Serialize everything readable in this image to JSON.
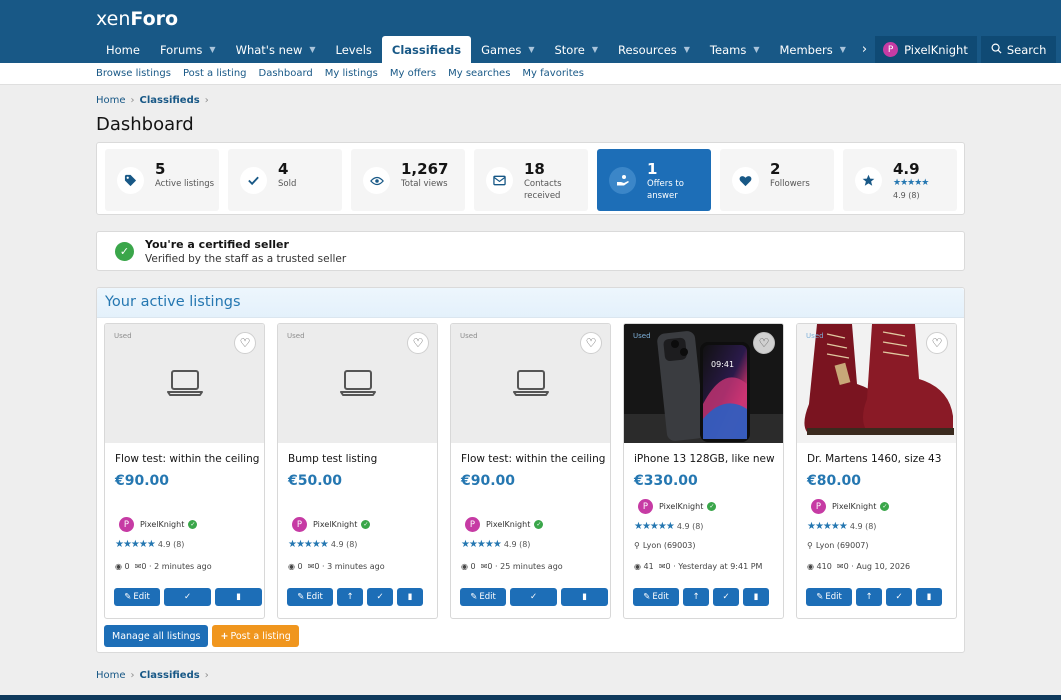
{
  "brand": {
    "logo_light": "xen",
    "logo_bold": "Foro"
  },
  "nav": {
    "tabs": [
      {
        "label": "Home",
        "caret": false,
        "active": false
      },
      {
        "label": "Forums",
        "caret": true,
        "active": false
      },
      {
        "label": "What's new",
        "caret": true,
        "active": false
      },
      {
        "label": "Levels",
        "caret": false,
        "active": false
      },
      {
        "label": "Classifieds",
        "caret": false,
        "active": true
      },
      {
        "label": "Games",
        "caret": true,
        "active": false
      },
      {
        "label": "Store",
        "caret": true,
        "active": false
      },
      {
        "label": "Resources",
        "caret": true,
        "active": false
      },
      {
        "label": "Teams",
        "caret": true,
        "active": false
      },
      {
        "label": "Members",
        "caret": true,
        "active": false
      }
    ],
    "user_initial": "P",
    "user_name": "PixelKnight",
    "search_label": "Search"
  },
  "subnav": [
    "Browse listings",
    "Post a listing",
    "Dashboard",
    "My listings",
    "My offers",
    "My searches",
    "My favorites"
  ],
  "breadcrumb": {
    "home": "Home",
    "section": "Classifieds"
  },
  "page_title": "Dashboard",
  "stats": [
    {
      "value": "5",
      "label": "Active listings",
      "icon": "tag-icon"
    },
    {
      "value": "4",
      "label": "Sold",
      "icon": "check-icon"
    },
    {
      "value": "1,267",
      "label": "Total views",
      "icon": "eye-icon"
    },
    {
      "value": "18",
      "label": "Contacts received",
      "icon": "envelope-icon"
    },
    {
      "value": "1",
      "label": "Offers to answer",
      "icon": "hand-coin-icon",
      "highlight": true
    },
    {
      "value": "2",
      "label": "Followers",
      "icon": "heart-icon"
    },
    {
      "value": "4.9",
      "label": "4.9 (8)",
      "icon": "star-icon",
      "rating": 4.9
    }
  ],
  "certified": {
    "title": "You're a certified seller",
    "text": "Verified by the staff as a trusted seller"
  },
  "listings_heading": "Your active listings",
  "listings": [
    {
      "condition": "Used",
      "title": "Flow test: within the ceiling",
      "price": "€90.00",
      "seller": "PixelKnight",
      "rating": "4.9 (8)",
      "location": "",
      "views": "0",
      "contacts": "0",
      "time": "2 minutes ago",
      "image": "placeholder",
      "bump": false
    },
    {
      "condition": "Used",
      "title": "Bump test listing",
      "price": "€50.00",
      "seller": "PixelKnight",
      "rating": "4.9 (8)",
      "location": "",
      "views": "0",
      "contacts": "0",
      "time": "3 minutes ago",
      "image": "placeholder",
      "bump": true
    },
    {
      "condition": "Used",
      "title": "Flow test: within the ceiling",
      "price": "€90.00",
      "seller": "PixelKnight",
      "rating": "4.9 (8)",
      "location": "",
      "views": "0",
      "contacts": "0",
      "time": "25 minutes ago",
      "image": "placeholder",
      "bump": false
    },
    {
      "condition": "Used",
      "title": "iPhone 13 128GB, like new",
      "price": "€330.00",
      "seller": "PixelKnight",
      "rating": "4.9 (8)",
      "location": "Lyon (69003)",
      "views": "41",
      "contacts": "0",
      "time": "Yesterday at 9:41 PM",
      "image": "iphone",
      "bump": true
    },
    {
      "condition": "Used",
      "title": "Dr. Martens 1460, size 43",
      "price": "€80.00",
      "seller": "PixelKnight",
      "rating": "4.9 (8)",
      "location": "Lyon (69007)",
      "views": "410",
      "contacts": "0",
      "time": "Aug 10, 2026",
      "image": "boots",
      "bump": true
    }
  ],
  "buttons": {
    "edit": "Edit",
    "manage": "Manage all listings",
    "post": "Post a listing"
  },
  "phone_clock": "09:41",
  "colors": {
    "header": "#185886",
    "accent": "#1d6eb7",
    "link": "#2577b1",
    "orange": "#f0961e",
    "success": "#3aa64a",
    "avatar": "#c63ba4"
  }
}
